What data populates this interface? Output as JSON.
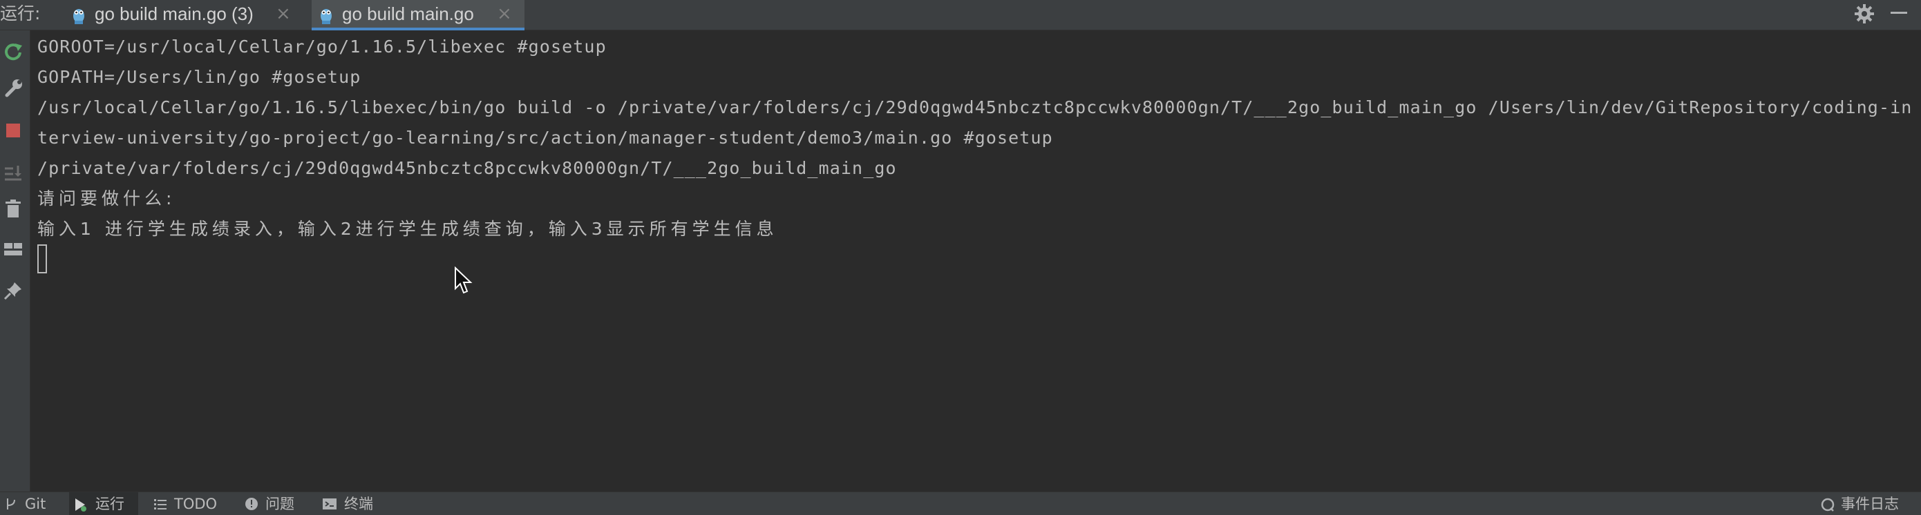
{
  "run_label": "运行:",
  "tabs": [
    {
      "label": "go build main.go (3)",
      "close": "×",
      "active": false,
      "icon": "go-gopher-icon"
    },
    {
      "label": "go build main.go",
      "close": "×",
      "active": true,
      "icon": "go-gopher-icon"
    }
  ],
  "toolbar_icons": [
    "rerun-icon",
    "wrench-icon",
    "stop-icon",
    "sort-down-icon",
    "trash-icon",
    "layout-icon",
    "pin-icon",
    "settings-gear-icon",
    "minimize-icon"
  ],
  "console": {
    "lines": [
      "GOROOT=/usr/local/Cellar/go/1.16.5/libexec #gosetup",
      "GOPATH=/Users/lin/go #gosetup",
      "/usr/local/Cellar/go/1.16.5/libexec/bin/go build -o /private/var/folders/cj/29d0qgwd45nbcztc8pccwkv80000gn/T/___2go_build_main_go /Users/lin/dev/GitRepository/coding-in",
      "terview-university/go-project/go-learning/src/action/manager-student/demo3/main.go #gosetup",
      "/private/var/folders/cj/29d0qgwd45nbcztc8pccwkv80000gn/T/___2go_build_main_go",
      "请问要做什么:",
      "输入1 进行学生成绩录入，输入2进行学生成绩查询，输入3显示所有学生信息"
    ]
  },
  "status_bar": {
    "git": "Git",
    "run": "运行",
    "todo": "TODO",
    "problems": "问题",
    "terminal": "终端",
    "event_log": "事件日志"
  },
  "colors": {
    "background": "#2b2b2b",
    "panel": "#3c3f41",
    "text": "#bbbbbb",
    "active_tab_underline": "#4a88c7",
    "rerun_green": "#59a869",
    "stop_red": "#c75450"
  }
}
